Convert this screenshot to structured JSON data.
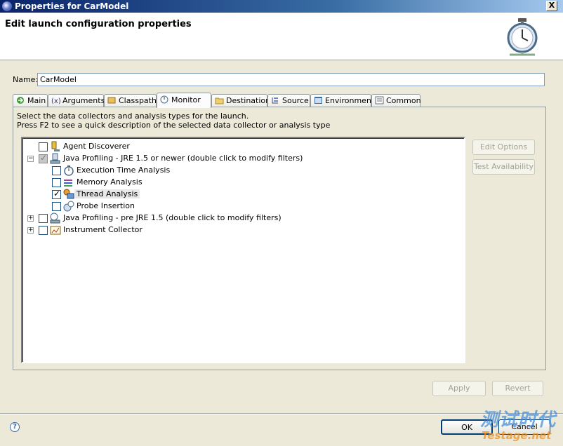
{
  "window": {
    "title": "Properties for CarModel",
    "close_label": "X"
  },
  "banner": {
    "heading": "Edit launch configuration properties"
  },
  "name_field": {
    "label": "Name:",
    "value": "CarModel"
  },
  "tabs": [
    {
      "label": "Main"
    },
    {
      "label": "Arguments"
    },
    {
      "label": "Classpath"
    },
    {
      "label": "Monitor"
    },
    {
      "label": "Destination"
    },
    {
      "label": "Source"
    },
    {
      "label": "Environment"
    },
    {
      "label": "Common"
    }
  ],
  "active_tab": "Monitor",
  "monitor": {
    "description_line1": "Select the data collectors and analysis types for the launch.",
    "description_line2": "Press F2 to see a quick description of the selected data collector or analysis type",
    "tree": [
      {
        "label": "Agent Discoverer",
        "checked": false
      },
      {
        "label": "Java Profiling - JRE 1.5 or newer (double click to modify filters)",
        "checked": "partial",
        "expanded": true
      },
      {
        "label": "Execution Time Analysis",
        "checked": false
      },
      {
        "label": "Memory Analysis",
        "checked": false
      },
      {
        "label": "Thread Analysis",
        "checked": true,
        "selected": true
      },
      {
        "label": "Probe Insertion",
        "checked": false
      },
      {
        "label": "Java Profiling - pre JRE 1.5 (double click to modify filters)",
        "checked": false,
        "expanded": false
      },
      {
        "label": "Instrument Collector",
        "checked": false,
        "expanded": false
      }
    ],
    "edit_options_label": "Edit Options",
    "test_availability_label": "Test Availability"
  },
  "footer": {
    "apply_label": "Apply",
    "revert_label": "Revert",
    "ok_label": "OK",
    "cancel_label": "Cancel",
    "help_label": "?"
  },
  "watermark": {
    "text_cn": "测试时代",
    "text_en": "Testage.net"
  },
  "colors": {
    "titlebar": "#0a246a",
    "selection": "#e8e8e8",
    "watermark_blue": "#4a8fd8",
    "watermark_orange": "#f08c1c"
  }
}
